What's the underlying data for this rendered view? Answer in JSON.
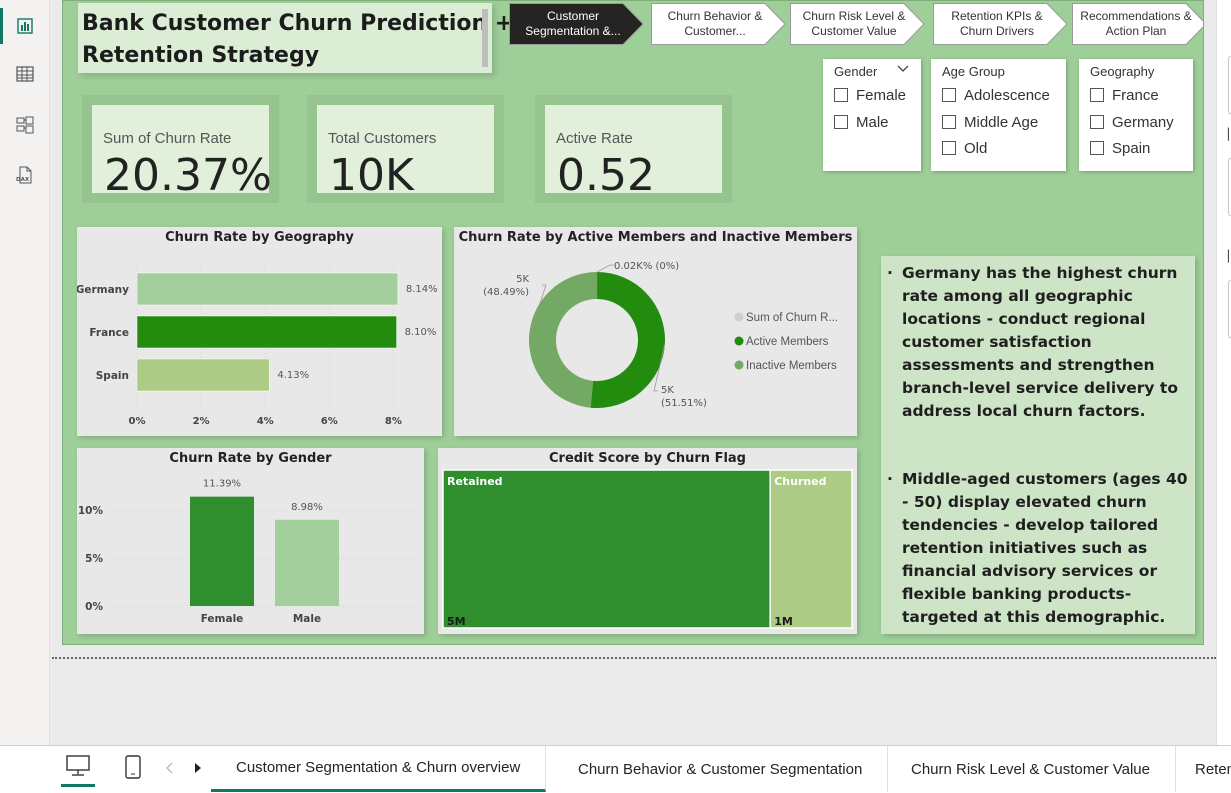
{
  "report": {
    "title": "Bank Customer Churn Prediction + Retention Strategy"
  },
  "nav_buttons": [
    {
      "label": "Customer Segmentation &...",
      "active": true
    },
    {
      "label": "Churn Behavior & Customer...",
      "active": false
    },
    {
      "label": "Churn Risk Level & Customer Value",
      "active": false
    },
    {
      "label": "Retention KPIs & Churn Drivers",
      "active": false
    },
    {
      "label": "Recommendations & Action Plan",
      "active": false
    }
  ],
  "kpis": [
    {
      "label": "Sum of Churn Rate",
      "value": "20.37%"
    },
    {
      "label": "Total Customers",
      "value": "10K"
    },
    {
      "label": "Active Rate",
      "value": "0.52"
    }
  ],
  "slicers": [
    {
      "title": "Gender",
      "options": [
        "Female",
        "Male"
      ]
    },
    {
      "title": "Age Group",
      "options": [
        "Adolescence",
        "Middle Age",
        "Old"
      ]
    },
    {
      "title": "Geography",
      "options": [
        "France",
        "Germany",
        "Spain"
      ]
    }
  ],
  "colors": {
    "canvas": "#9fcf99",
    "dark_green": "#2f8f2f",
    "mid_green": "#238c0e",
    "light_green": "#a3cf9c",
    "pale_green": "#accb84",
    "panel_bg": "#e8e8e8",
    "nav_active": "#252423",
    "accent_teal": "#117865"
  },
  "chart_data": [
    {
      "type": "bar",
      "orientation": "horizontal",
      "title": "Churn Rate by Geography",
      "categories": [
        "Germany",
        "France",
        "Spain"
      ],
      "values": [
        8.14,
        8.1,
        4.13
      ],
      "data_labels": [
        "8.14%",
        "8.10%",
        "4.13%"
      ],
      "xlim": [
        0,
        8.3
      ],
      "x_ticks": [
        "0%",
        "2%",
        "4%",
        "6%",
        "8%"
      ],
      "x_tick_values": [
        0,
        2,
        4,
        6,
        8
      ]
    },
    {
      "type": "pie",
      "donut": true,
      "title": "Churn Rate by Active Members and Inactive Members",
      "slices": [
        {
          "name": "Sum of Churn Rate",
          "value": 0.02,
          "label": "0.02K% (0%)"
        },
        {
          "name": "Active Members",
          "value": 51.51,
          "label": "5K (51.51%)"
        },
        {
          "name": "Inactive Members",
          "value": 48.49,
          "label": "5K (48.49%)"
        }
      ],
      "legend": [
        "Sum of Churn R...",
        "Active Members",
        "Inactive Members"
      ],
      "legend_placement": "right"
    },
    {
      "type": "bar",
      "title": "Churn Rate by Gender",
      "categories": [
        "Female",
        "Male"
      ],
      "values": [
        11.39,
        8.98
      ],
      "data_labels": [
        "11.39%",
        "8.98%"
      ],
      "ylim": [
        0,
        12.5
      ],
      "y_ticks": [
        "0%",
        "5%",
        "10%"
      ],
      "y_tick_values": [
        0,
        5,
        10
      ]
    },
    {
      "type": "treemap",
      "title": "Credit Score by Churn Flag",
      "items": [
        {
          "name": "Retained",
          "value_label": "5M",
          "value": 5.2
        },
        {
          "name": "Churned",
          "value_label": "1M",
          "value": 1.3
        }
      ]
    }
  ],
  "notes": [
    "Germany has the highest churn rate among all geographic locations - conduct regional customer satisfaction assessments and strengthen branch-level service delivery to address local churn factors.",
    "Middle-aged customers (ages 40 - 50) display elevated churn tendencies - develop tailored retention initiatives such as financial advisory services or flexible banking products- targeted at this demographic."
  ],
  "page_tabs": [
    {
      "label": "Customer Segmentation & Churn overview",
      "active": true
    },
    {
      "label": "Churn Behavior & Customer Segmentation",
      "active": false
    },
    {
      "label": "Churn Risk Level & Customer Value",
      "active": false
    },
    {
      "label": "Retention KPIs & Churn Drivers",
      "active": false
    }
  ],
  "icons": {
    "rail": [
      "report-view-icon",
      "table-view-icon",
      "model-view-icon",
      "dax-query-icon"
    ],
    "bottom": [
      "desktop-layout-icon",
      "mobile-layout-icon",
      "prev-page-icon",
      "next-page-icon"
    ]
  }
}
